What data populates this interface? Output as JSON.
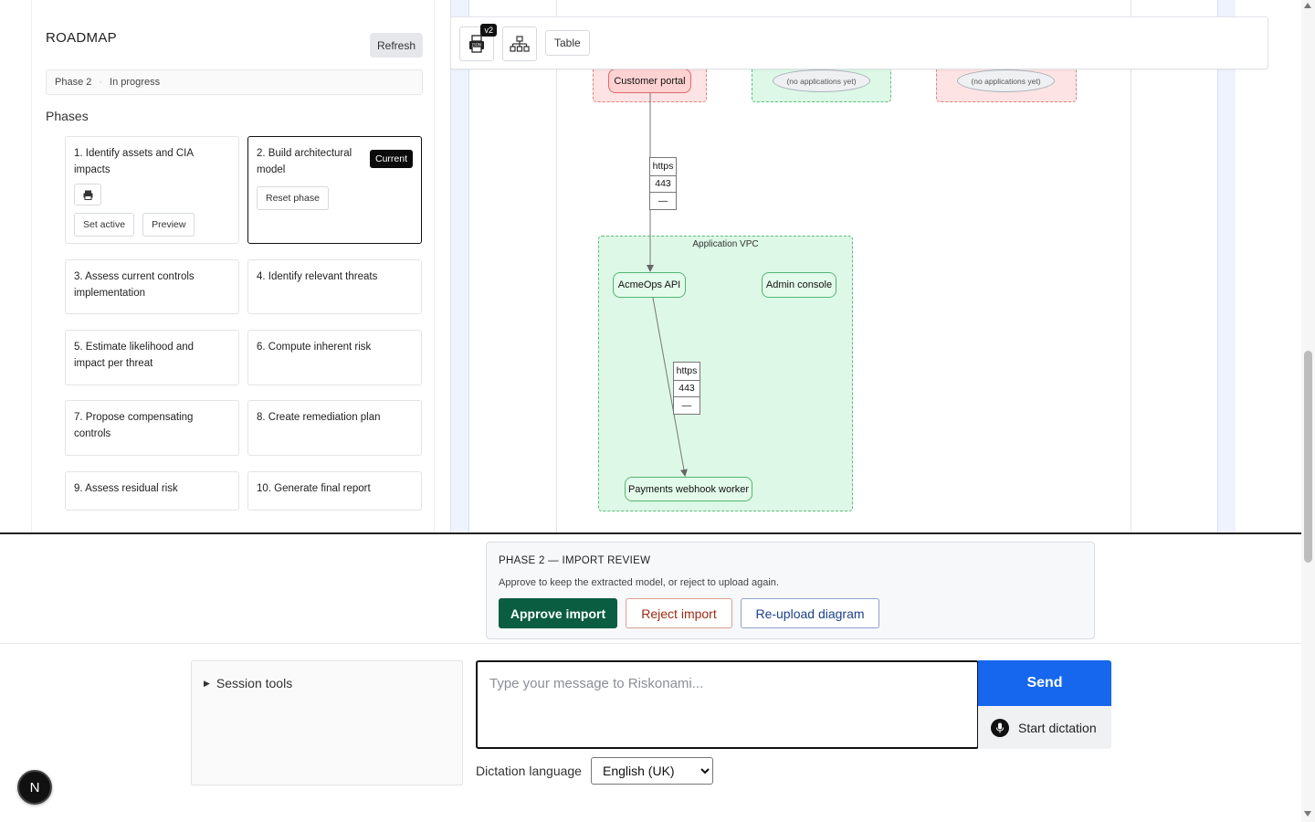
{
  "roadmap": {
    "title": "ROADMAP",
    "refresh_label": "Refresh",
    "status_phase": "Phase 2",
    "status_separator": "·",
    "status_text": "In progress",
    "phases_heading": "Phases",
    "phases": [
      {
        "title": "1. Identify assets and CIA impacts",
        "set_active_label": "Set active",
        "preview_label": "Preview"
      },
      {
        "title": "2. Build architectural model",
        "badge": "Current",
        "reset_label": "Reset phase"
      },
      {
        "title": "3. Assess current controls implementation"
      },
      {
        "title": "4. Identify relevant threats"
      },
      {
        "title": "5. Estimate likelihood and impact per threat"
      },
      {
        "title": "6. Compute inherent risk"
      },
      {
        "title": "7. Propose compensating controls"
      },
      {
        "title": "8. Create remediation plan"
      },
      {
        "title": "9. Assess residual risk"
      },
      {
        "title": "10. Generate final report"
      }
    ]
  },
  "toolbar": {
    "version_badge": "v2",
    "table_label": "Table",
    "json_icon": "json-file-icon",
    "tree_icon": "hierarchy-icon"
  },
  "diagram": {
    "nodes": {
      "customer_portal": "Customer portal",
      "empty_zone_1": "(no applications yet)",
      "empty_zone_2": "(no applications yet)",
      "app_vpc_label": "Application VPC",
      "acmeops_api": "AcmeOps API",
      "admin_console": "Admin console",
      "payments_worker": "Payments webhook worker"
    },
    "edges": [
      {
        "protocol": "https",
        "port": "443",
        "extra": "—"
      },
      {
        "protocol": "https",
        "port": "443",
        "extra": "—"
      }
    ],
    "colors": {
      "zone_red": "#fde3e3",
      "zone_green": "#ddf8e6"
    }
  },
  "review": {
    "title": "PHASE 2 — IMPORT REVIEW",
    "description": "Approve to keep the extracted model, or reject to upload again.",
    "approve_label": "Approve import",
    "reject_label": "Reject import",
    "reupload_label": "Re-upload diagram"
  },
  "composer": {
    "session_tools_label": "Session tools",
    "message_placeholder": "Type your message to Riskonami...",
    "message_value": "",
    "send_label": "Send",
    "dictation_label": "Start dictation",
    "dictation_language_label": "Dictation language",
    "dictation_language_selected": "English (UK)"
  },
  "avatar": {
    "initial": "N"
  }
}
